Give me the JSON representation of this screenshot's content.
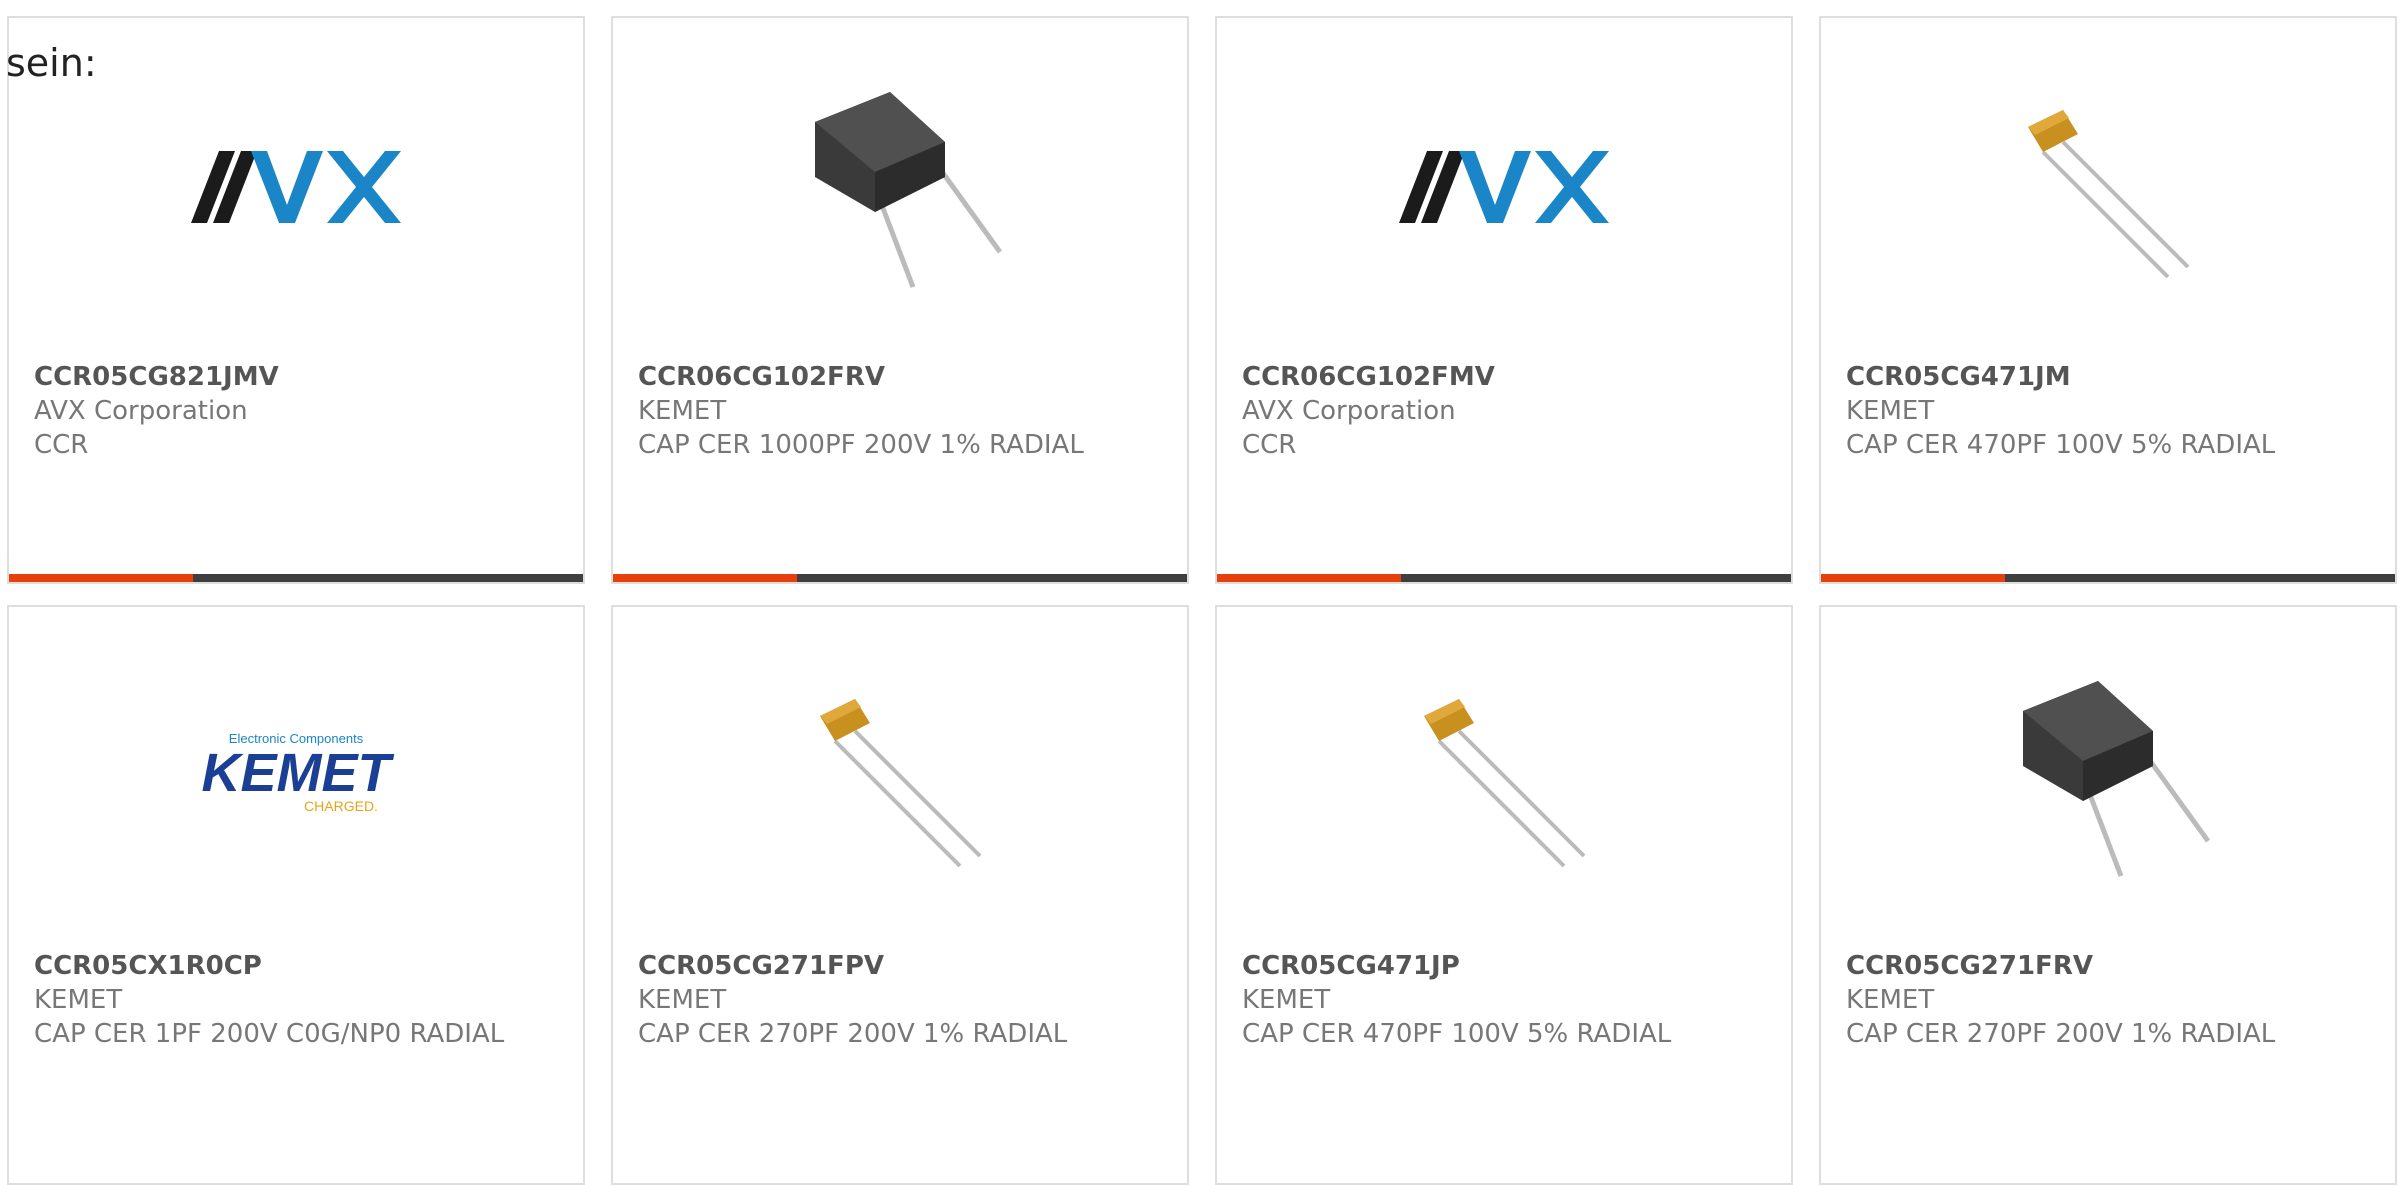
{
  "intro": "sein:",
  "colors": {
    "accent": "#e8400c",
    "bar": "#3f3f3f",
    "avx_black": "#1b1b1b",
    "avx_blue": "#1a86c8",
    "kemet_blue": "#1b3f94",
    "kemet_gold": "#e8a417"
  },
  "products": [
    {
      "part": "CCR05CG821JMV",
      "maker": "AVX Corporation",
      "desc": "CCR",
      "image": "avx-logo"
    },
    {
      "part": "CCR06CG102FRV",
      "maker": "KEMET",
      "desc": "CAP CER 1000PF 200V 1% RADIAL",
      "image": "capacitor-black-icon"
    },
    {
      "part": "CCR06CG102FMV",
      "maker": "AVX Corporation",
      "desc": "CCR",
      "image": "avx-logo"
    },
    {
      "part": "CCR05CG471JM",
      "maker": "KEMET",
      "desc": "CAP CER 470PF 100V 5% RADIAL",
      "image": "capacitor-yellow-icon"
    },
    {
      "part": "CCR05CX1R0CP",
      "maker": "KEMET",
      "desc": "CAP CER 1PF 200V C0G/NP0 RADIAL",
      "image": "kemet-logo"
    },
    {
      "part": "CCR05CG271FPV",
      "maker": "KEMET",
      "desc": "CAP CER 270PF 200V 1% RADIAL",
      "image": "capacitor-yellow-icon"
    },
    {
      "part": "CCR05CG471JP",
      "maker": "KEMET",
      "desc": "CAP CER 470PF 100V 5% RADIAL",
      "image": "capacitor-yellow-icon"
    },
    {
      "part": "CCR05CG271FRV",
      "maker": "KEMET",
      "desc": "CAP CER 270PF 200V 1% RADIAL",
      "image": "capacitor-black-icon"
    }
  ],
  "kemet_logo": {
    "top": "Electronic Components",
    "name": "KEMET",
    "tag": "CHARGED."
  },
  "avx_logo": {
    "name": "AVX"
  }
}
